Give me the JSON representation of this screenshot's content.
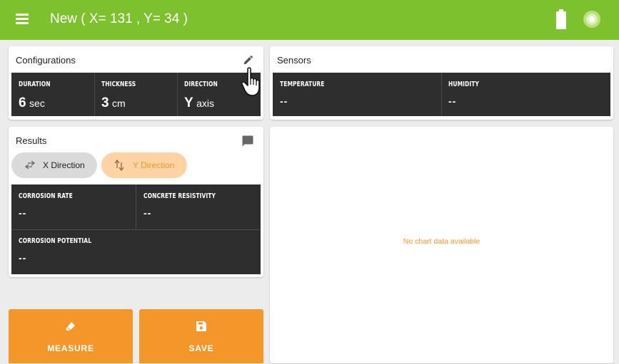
{
  "appbar": {
    "title": "New ( X= 131 , Y= 34 )",
    "background_color": "#7dc22e",
    "menu_icon": "hamburger-menu-icon",
    "battery_icon": "battery-full-icon",
    "status_icon": "connection-status-icon"
  },
  "configurations": {
    "title": "Configurations",
    "edit_icon": "pencil-icon",
    "cells": [
      {
        "label": "DURATION",
        "value": "6",
        "unit": "sec"
      },
      {
        "label": "THICKNESS",
        "value": "3",
        "unit": "cm"
      },
      {
        "label": "DIRECTION",
        "value": "Y",
        "unit": "axis"
      }
    ]
  },
  "sensors": {
    "title": "Sensors",
    "cells": [
      {
        "label": "TEMPERATURE",
        "value": "--"
      },
      {
        "label": "HUMIDITY",
        "value": "--"
      }
    ]
  },
  "results": {
    "title": "Results",
    "comment_icon": "comment-icon",
    "chips": [
      {
        "label": "X Direction",
        "icon": "swap-horizontal-icon",
        "selected": false
      },
      {
        "label": "Y Direction",
        "icon": "swap-vertical-icon",
        "selected": true
      }
    ],
    "cells": [
      {
        "label": "CORROSION RATE",
        "value": "--"
      },
      {
        "label": "CONCRETE RESISTIVITY",
        "value": "--"
      },
      {
        "label": "CORROSION POTENTIAL",
        "value": "--"
      }
    ]
  },
  "chart": {
    "empty_message": "No chart data available"
  },
  "actions": {
    "measure_label": "MEASURE",
    "measure_icon": "eraser-icon",
    "save_label": "SAVE",
    "save_icon": "floppy-disk-icon"
  },
  "colors": {
    "accent_green": "#7dc22e",
    "accent_orange": "#f5962a",
    "chip_selected_bg": "#fdd3a6",
    "chip_unselected_bg": "#dadada",
    "panel_dark": "#2e2e2e"
  }
}
